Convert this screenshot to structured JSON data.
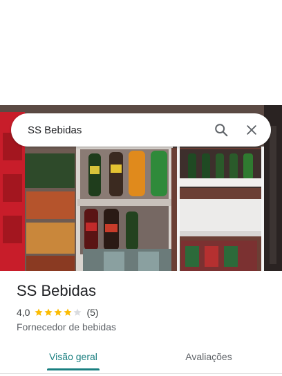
{
  "search": {
    "query": "SS Bebidas",
    "search_icon": "search-icon",
    "close_icon": "close-icon"
  },
  "place": {
    "name": "SS Bebidas",
    "rating": "4,0",
    "rating_value": 4.0,
    "rating_max": 5,
    "review_count": "(5)",
    "category": "Fornecedor de bebidas"
  },
  "tabs": [
    {
      "label": "Visão geral",
      "selected": true
    },
    {
      "label": "Avaliações",
      "selected": false
    }
  ],
  "colors": {
    "accent": "#1a7f80",
    "star": "#fbbc04",
    "star_empty": "#dadce0"
  }
}
